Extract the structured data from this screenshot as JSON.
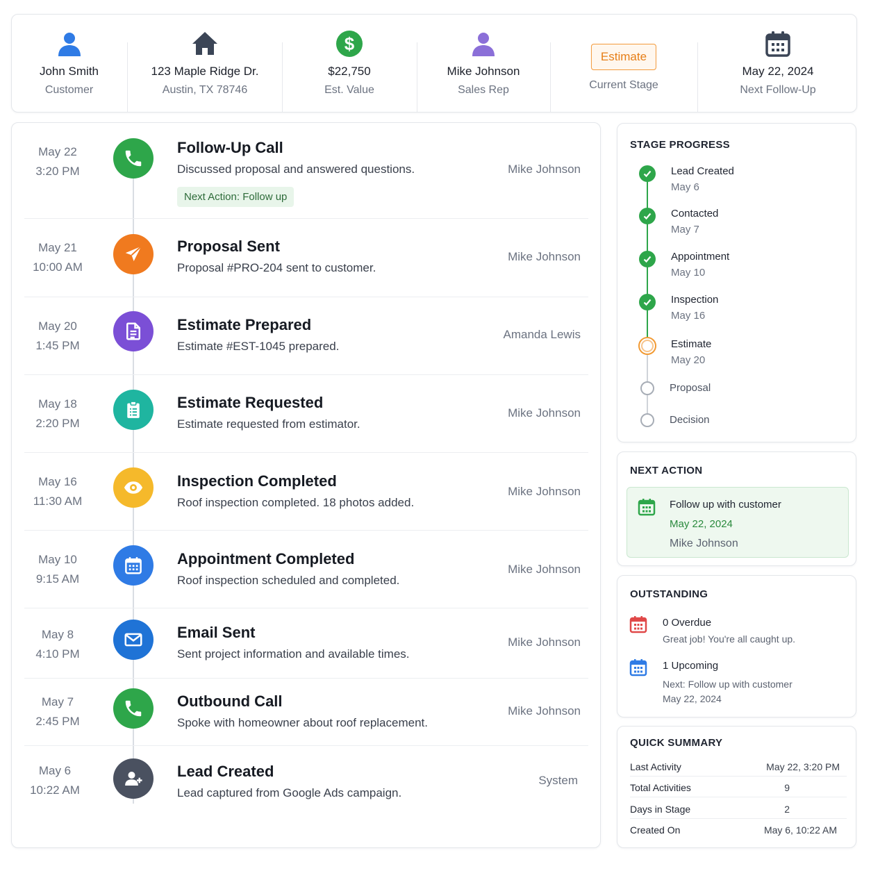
{
  "header": {
    "customer": {
      "name": "John Smith",
      "label": "Customer",
      "icon": "person-icon",
      "color": "#2f7be5"
    },
    "address": {
      "line1": "123 Maple Ridge Dr.",
      "line2": "Austin, TX 78746",
      "icon": "house-icon",
      "color": "#3b4556"
    },
    "value": {
      "amount": "$22,750",
      "label": "Est. Value",
      "icon": "dollar-icon",
      "color": "#2ea64a"
    },
    "rep": {
      "name": "Mike Johnson",
      "label": "Sales Rep",
      "icon": "person-icon",
      "color": "#8b6fd8"
    },
    "stage": {
      "badge": "Estimate",
      "label": "Current Stage"
    },
    "followup": {
      "date": "May 22, 2024",
      "label": "Next Follow-Up",
      "icon": "calendar-icon",
      "color": "#3b4556"
    }
  },
  "timeline": [
    {
      "date": "May 22",
      "time": "3:20 PM",
      "title": "Follow-Up Call",
      "desc": "Discussed proposal and answered questions.",
      "who": "Mike Johnson",
      "icon": "phone-icon",
      "color": "#2ea64a",
      "next": "Next Action: Follow up"
    },
    {
      "date": "May 21",
      "time": "10:00 AM",
      "title": "Proposal Sent",
      "desc": "Proposal #PRO-204 sent to customer.",
      "who": "Mike Johnson",
      "icon": "send-icon",
      "color": "#f07a1f"
    },
    {
      "date": "May 20",
      "time": "1:45 PM",
      "title": "Estimate Prepared",
      "desc": "Estimate #EST-1045 prepared.",
      "who": "Amanda Lewis",
      "icon": "document-icon",
      "color": "#7b4fd6"
    },
    {
      "date": "May 18",
      "time": "2:20 PM",
      "title": "Estimate Requested",
      "desc": "Estimate requested from estimator.",
      "who": "Mike Johnson",
      "icon": "clipboard-icon",
      "color": "#1fb5a0"
    },
    {
      "date": "May 16",
      "time": "11:30 AM",
      "title": "Inspection Completed",
      "desc": "Roof inspection completed. 18 photos added.",
      "who": "Mike Johnson",
      "icon": "eye-icon",
      "color": "#f5b92b"
    },
    {
      "date": "May 10",
      "time": "9:15 AM",
      "title": "Appointment Completed",
      "desc": "Roof inspection scheduled and completed.",
      "who": "Mike Johnson",
      "icon": "calendar-icon",
      "color": "#2f7be5"
    },
    {
      "date": "May 8",
      "time": "4:10 PM",
      "title": "Email Sent",
      "desc": "Sent project information and available times.",
      "who": "Mike Johnson",
      "icon": "envelope-icon",
      "color": "#1f73d6"
    },
    {
      "date": "May 7",
      "time": "2:45 PM",
      "title": "Outbound Call",
      "desc": "Spoke with homeowner about roof replacement.",
      "who": "Mike Johnson",
      "icon": "phone-icon",
      "color": "#2ea64a"
    },
    {
      "date": "May 6",
      "time": "10:22 AM",
      "title": "Lead Created",
      "desc": "Lead captured from Google Ads campaign.",
      "who": "System",
      "icon": "add-user-icon",
      "color": "#4a5160"
    }
  ],
  "stage_progress": {
    "title": "STAGE PROGRESS",
    "stages": [
      {
        "name": "Lead Created",
        "date": "May 6",
        "status": "done"
      },
      {
        "name": "Contacted",
        "date": "May 7",
        "status": "done"
      },
      {
        "name": "Appointment",
        "date": "May 10",
        "status": "done"
      },
      {
        "name": "Inspection",
        "date": "May 16",
        "status": "done"
      },
      {
        "name": "Estimate",
        "date": "May 20",
        "status": "current"
      },
      {
        "name": "Proposal",
        "date": "",
        "status": "todo"
      },
      {
        "name": "Decision",
        "date": "",
        "status": "todo"
      }
    ]
  },
  "next_action": {
    "title": "NEXT ACTION",
    "task": "Follow up with customer",
    "date": "May 22, 2024",
    "who": "Mike Johnson"
  },
  "outstanding": {
    "title": "OUTSTANDING",
    "overdue": {
      "title": "0 Overdue",
      "sub": "Great job! You're all caught up."
    },
    "upcoming": {
      "title": "1 Upcoming",
      "sub1": "Next: Follow up with customer",
      "sub2": "May 22, 2024"
    }
  },
  "quick_summary": {
    "title": "QUICK SUMMARY",
    "rows": [
      {
        "label": "Last Activity",
        "value": "May 22, 3:20 PM"
      },
      {
        "label": "Total Activities",
        "value": "9"
      },
      {
        "label": "Days in Stage",
        "value": "2"
      },
      {
        "label": "Created On",
        "value": "May 6, 10:22 AM"
      }
    ]
  },
  "colors": {
    "success": "#2ea64a",
    "warning": "#f07a1f",
    "accent": "#2f7be5"
  }
}
